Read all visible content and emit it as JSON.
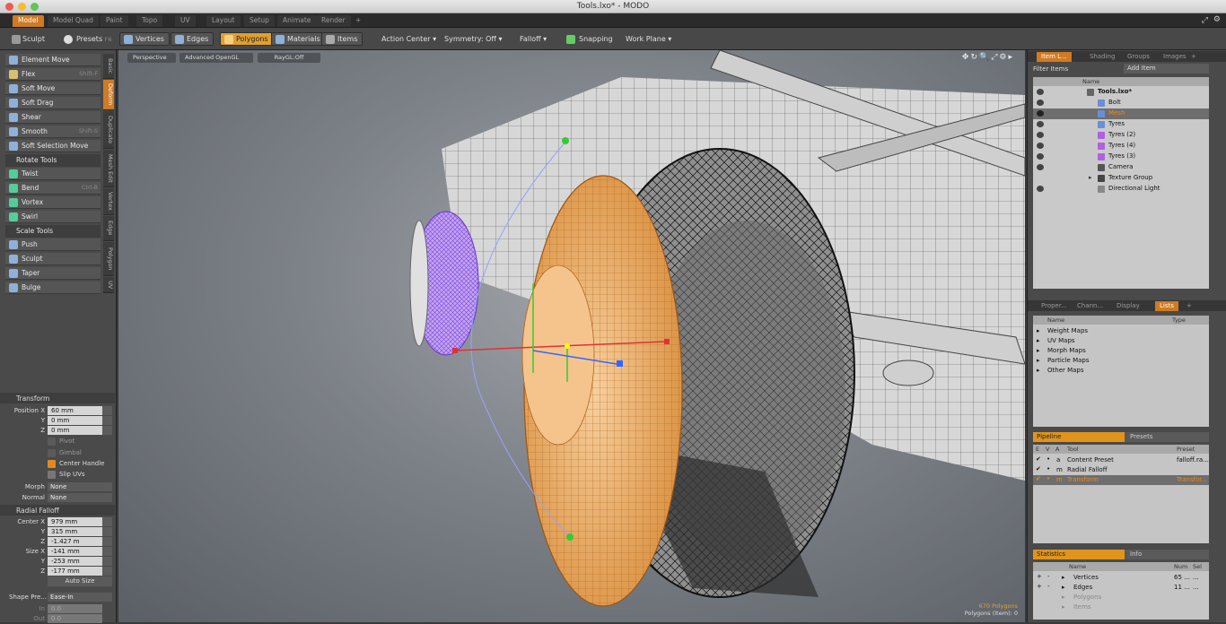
{
  "window": {
    "title": "Tools.lxo* - MODO"
  },
  "layout_tabs": [
    "Model",
    "Model Quad",
    "Paint",
    "Topo",
    "UV",
    "Layout",
    "Setup",
    "Animate",
    "Render",
    "+"
  ],
  "toolbar": {
    "sculpt": "Sculpt",
    "presets": "Presets",
    "presets_shortcut": "F6",
    "vertices": "Vertices",
    "edges": "Edges",
    "polygons": "Polygons",
    "materials": "Materials",
    "items": "Items",
    "action_center": "Action Center",
    "symmetry": "Symmetry: Off",
    "falloff": "Falloff",
    "snapping": "Snapping",
    "work_plane": "Work Plane"
  },
  "side_tabs": [
    "Basic",
    "Deform",
    "Duplicate",
    "Mesh Edit",
    "Vertex",
    "Edge",
    "Polygon",
    "UV"
  ],
  "tools": [
    {
      "label": "Element Move",
      "shortcut": "",
      "type": "tool"
    },
    {
      "label": "Flex",
      "shortcut": "Shift-F",
      "type": "tool"
    },
    {
      "label": "Soft Move",
      "shortcut": "",
      "type": "tool"
    },
    {
      "label": "Soft Drag",
      "shortcut": "",
      "type": "tool"
    },
    {
      "label": "Shear",
      "shortcut": "",
      "type": "tool"
    },
    {
      "label": "Smooth",
      "shortcut": "Shift-S",
      "type": "tool"
    },
    {
      "label": "Soft Selection Move",
      "shortcut": "",
      "type": "tool"
    },
    {
      "label": "Rotate Tools",
      "shortcut": "",
      "type": "header"
    },
    {
      "label": "Twist",
      "shortcut": "",
      "type": "tool"
    },
    {
      "label": "Bend",
      "shortcut": "Ctrl-B",
      "type": "tool"
    },
    {
      "label": "Vortex",
      "shortcut": "",
      "type": "tool"
    },
    {
      "label": "Swirl",
      "shortcut": "",
      "type": "tool"
    },
    {
      "label": "Scale Tools",
      "shortcut": "",
      "type": "header"
    },
    {
      "label": "Push",
      "shortcut": "",
      "type": "tool"
    },
    {
      "label": "Sculpt",
      "shortcut": "",
      "type": "tool"
    },
    {
      "label": "Taper",
      "shortcut": "",
      "type": "tool"
    },
    {
      "label": "Bulge",
      "shortcut": "",
      "type": "tool"
    }
  ],
  "transform": {
    "title": "Transform",
    "position_x_label": "Position X",
    "position_x": "60 mm",
    "y_label": "Y",
    "position_y": "0 mm",
    "z_label": "Z",
    "position_z": "0 mm",
    "pivot": "Pivot",
    "gimbal": "Gimbal",
    "center_handle": "Center Handle",
    "slip_uvs": "Slip UVs",
    "morph_label": "Morph",
    "morph_value": "None",
    "normal_label": "Normal",
    "normal_value": "None"
  },
  "radial_falloff": {
    "title": "Radial Falloff",
    "center_x_label": "Center X",
    "center_x": "979 mm",
    "center_y": "315 mm",
    "center_z": "-1.427 m",
    "size_x_label": "Size X",
    "size_x": "-141 mm",
    "size_y": "-253 mm",
    "size_z": "-177 mm",
    "auto_size": "Auto Size",
    "shape_preset_label": "Shape Pre...",
    "shape_preset": "Ease-In",
    "in_label": "In",
    "in_value": "0.0",
    "out_label": "Out",
    "out_value": "0.0"
  },
  "viewport": {
    "perspective": "Perspective",
    "renderer": "Advanced OpenGL",
    "raygl": "RayGL:Off",
    "status_line1": "670 Polygons",
    "status_line2": "Polygons (Item): 0"
  },
  "items_panel": {
    "tabs": [
      "Item L...",
      "Shading",
      "Groups",
      "Images",
      "+"
    ],
    "filter": "Filter Items",
    "add_item": "Add Item",
    "name_header": "Name",
    "items": [
      {
        "name": "Tools.lxo*",
        "depth": 0,
        "icon": "scene-icon",
        "selected": false
      },
      {
        "name": "Bolt",
        "depth": 1,
        "icon": "mesh-icon",
        "selected": false
      },
      {
        "name": "Mesh",
        "depth": 1,
        "icon": "mesh-icon",
        "selected": true
      },
      {
        "name": "Tyres",
        "depth": 1,
        "icon": "mesh-icon",
        "selected": false
      },
      {
        "name": "Tyres (2)",
        "depth": 1,
        "icon": "mesh-instance-icon",
        "selected": false
      },
      {
        "name": "Tyres (4)",
        "depth": 1,
        "icon": "mesh-instance-icon",
        "selected": false
      },
      {
        "name": "Tyres (3)",
        "depth": 1,
        "icon": "mesh-instance-icon",
        "selected": false
      },
      {
        "name": "Camera",
        "depth": 1,
        "icon": "camera-icon",
        "selected": false
      },
      {
        "name": "Texture Group",
        "depth": 1,
        "icon": "group-icon",
        "selected": false
      },
      {
        "name": "Directional Light",
        "depth": 1,
        "icon": "light-icon",
        "selected": false
      }
    ]
  },
  "lists_panel": {
    "tabs": [
      "Proper...",
      "Chann...",
      "Display",
      "Lists",
      "+"
    ],
    "name_header": "Name",
    "type_header": "Type",
    "items": [
      "Weight Maps",
      "UV Maps",
      "Morph Maps",
      "Particle Maps",
      "Other Maps"
    ]
  },
  "pipeline_panel": {
    "tab": "Pipeline",
    "presets_tab": "Presets",
    "headers": [
      "E",
      "V",
      "A",
      "Tool",
      "Preset"
    ],
    "rows": [
      {
        "a": "a",
        "tool": "Content Preset",
        "preset": "falloff.ra..."
      },
      {
        "a": "m",
        "tool": "Radial Falloff",
        "preset": ""
      },
      {
        "a": "m",
        "tool": "Transform",
        "preset": "Transfor..."
      }
    ]
  },
  "statistics_panel": {
    "tab": "Statistics",
    "info_tab": "Info",
    "headers": [
      "Name",
      "Num",
      "Sel"
    ],
    "rows": [
      {
        "name": "Vertices",
        "num": "65 ...",
        "sel": "..."
      },
      {
        "name": "Edges",
        "num": "11 ...",
        "sel": "..."
      },
      {
        "name": "Polygons",
        "num": "",
        "sel": ""
      },
      {
        "name": "Items",
        "num": "",
        "sel": ""
      }
    ]
  },
  "colors": {
    "accent": "#d07a22",
    "selection": "#e0a030",
    "wheel": "#e8a45a",
    "tyre_purple": "#b48cf0"
  }
}
